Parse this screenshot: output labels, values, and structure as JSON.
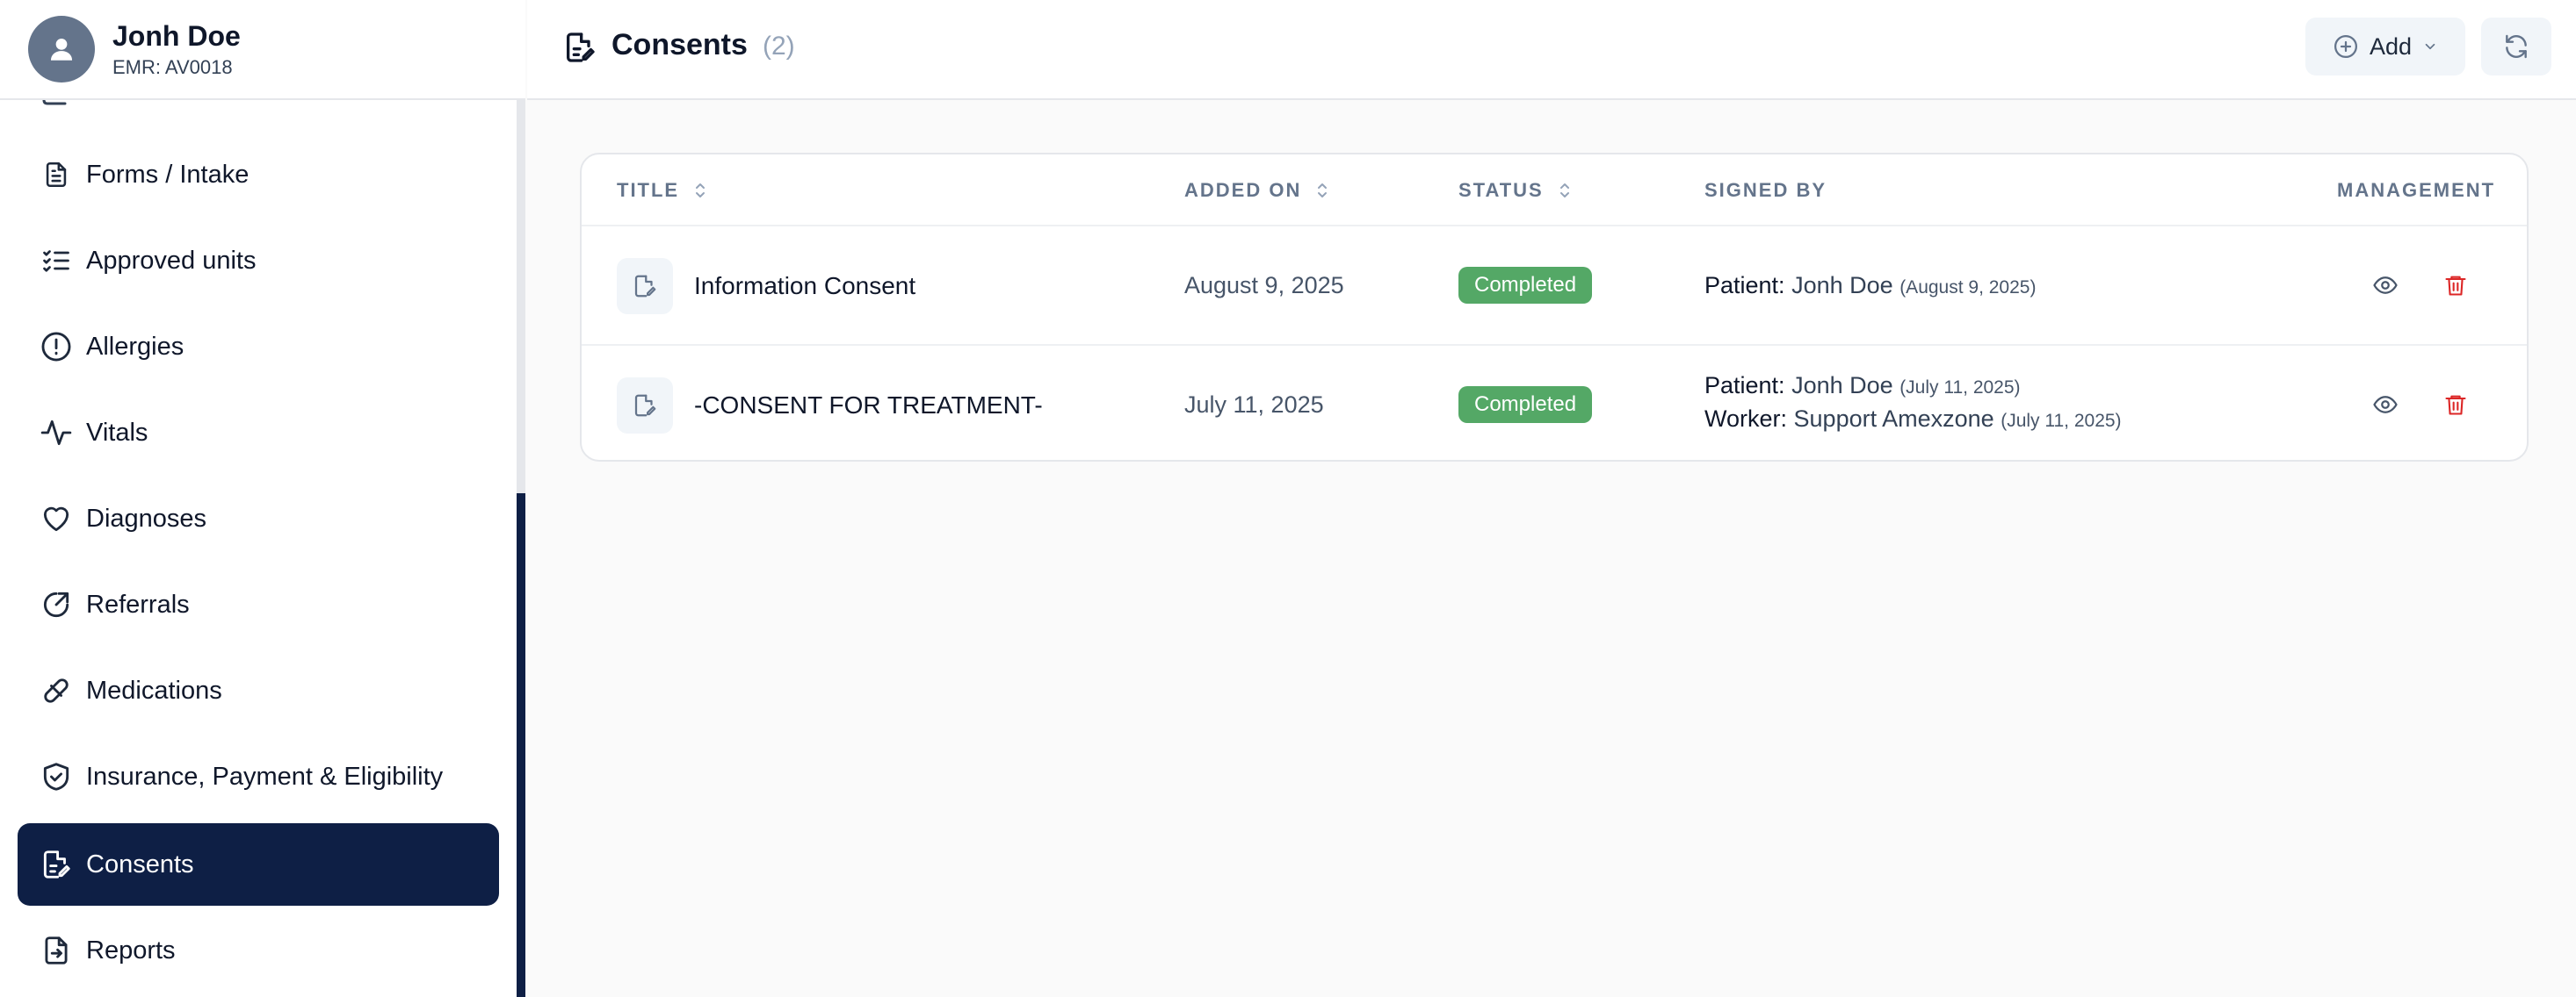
{
  "patient": {
    "name": "Jonh Doe",
    "emr": "EMR: AV0018"
  },
  "sidebar": {
    "items": [
      {
        "label": "Forms / Intake",
        "icon": "document-icon"
      },
      {
        "label": "Approved units",
        "icon": "checklist-icon"
      },
      {
        "label": "Allergies",
        "icon": "alert-circle-icon"
      },
      {
        "label": "Vitals",
        "icon": "activity-icon"
      },
      {
        "label": "Diagnoses",
        "icon": "heart-icon"
      },
      {
        "label": "Referrals",
        "icon": "external-link-icon"
      },
      {
        "label": "Medications",
        "icon": "pill-icon"
      },
      {
        "label": "Insurance, Payment & Eligibility",
        "icon": "shield-check-icon"
      },
      {
        "label": "Consents",
        "icon": "document-edit-icon",
        "active": true
      },
      {
        "label": "Reports",
        "icon": "file-export-icon"
      }
    ]
  },
  "header": {
    "title": "Consents",
    "count": "(2)",
    "add_label": "Add"
  },
  "table": {
    "columns": {
      "title": "TITLE",
      "added_on": "ADDED ON",
      "status": "STATUS",
      "signed_by": "SIGNED BY",
      "management": "MANAGEMENT"
    },
    "rows": [
      {
        "title": "Information Consent",
        "added_on": "August 9, 2025",
        "status": "Completed",
        "signers": [
          {
            "role": "Patient:",
            "name": "Jonh Doe",
            "date": "(August 9, 2025)"
          }
        ]
      },
      {
        "title": "-CONSENT FOR TREATMENT-",
        "added_on": "July 11, 2025",
        "status": "Completed",
        "signers": [
          {
            "role": "Patient:",
            "name": "Jonh Doe",
            "date": "(July 11, 2025)"
          },
          {
            "role": "Worker:",
            "name": "Support Amexzone",
            "date": "(July 11, 2025)"
          }
        ]
      }
    ]
  },
  "colors": {
    "accent": "#0e1f45",
    "status_completed": "#54a866",
    "delete": "#dc2626"
  }
}
